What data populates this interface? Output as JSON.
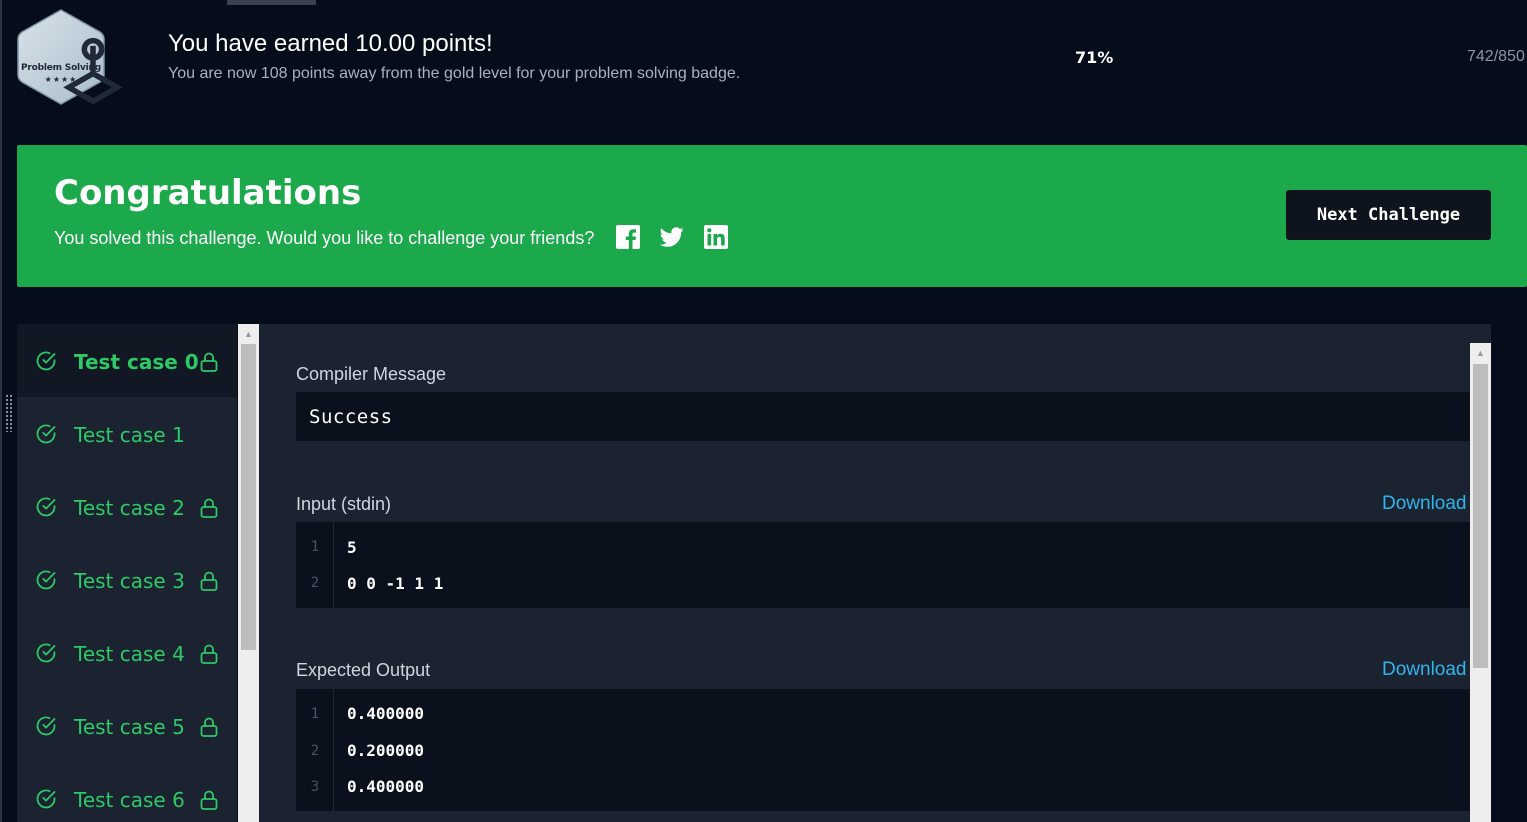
{
  "header": {
    "badge": {
      "label": "Problem Solving",
      "stars": "★★★★"
    },
    "earned_title": "You have earned 10.00 points!",
    "earned_sub": "You are now 108 points away from the gold level for your problem solving badge.",
    "progress_pct": "71%",
    "progress_count": "742/850"
  },
  "congrats": {
    "title": "Congratulations",
    "text": "You solved this challenge. Would you like to challenge your friends?",
    "next_button": "Next Challenge",
    "share_icons": [
      "facebook-icon",
      "twitter-icon",
      "linkedin-icon"
    ]
  },
  "test_cases": [
    {
      "label": "Test case 0",
      "locked": true,
      "active": true
    },
    {
      "label": "Test case 1",
      "locked": false,
      "active": false
    },
    {
      "label": "Test case 2",
      "locked": true,
      "active": false
    },
    {
      "label": "Test case 3",
      "locked": true,
      "active": false
    },
    {
      "label": "Test case 4",
      "locked": true,
      "active": false
    },
    {
      "label": "Test case 5",
      "locked": true,
      "active": false
    },
    {
      "label": "Test case 6",
      "locked": true,
      "active": false
    }
  ],
  "result": {
    "compiler_label": "Compiler Message",
    "compiler_message": "Success",
    "input_label": "Input (stdin)",
    "download_label": "Download",
    "input_lines": [
      {
        "n": "1",
        "text": "5"
      },
      {
        "n": "2",
        "text": "0 0 -1 1 1"
      }
    ],
    "expected_label": "Expected Output",
    "expected_lines": [
      {
        "n": "1",
        "text": "0.400000"
      },
      {
        "n": "2",
        "text": "0.200000"
      },
      {
        "n": "3",
        "text": "0.400000"
      }
    ]
  },
  "colors": {
    "background": "#050c1a",
    "success_green": "#1ba94c",
    "test_green": "#2ec866",
    "link_blue": "#2fb5ea",
    "panel": "#1b2230"
  }
}
